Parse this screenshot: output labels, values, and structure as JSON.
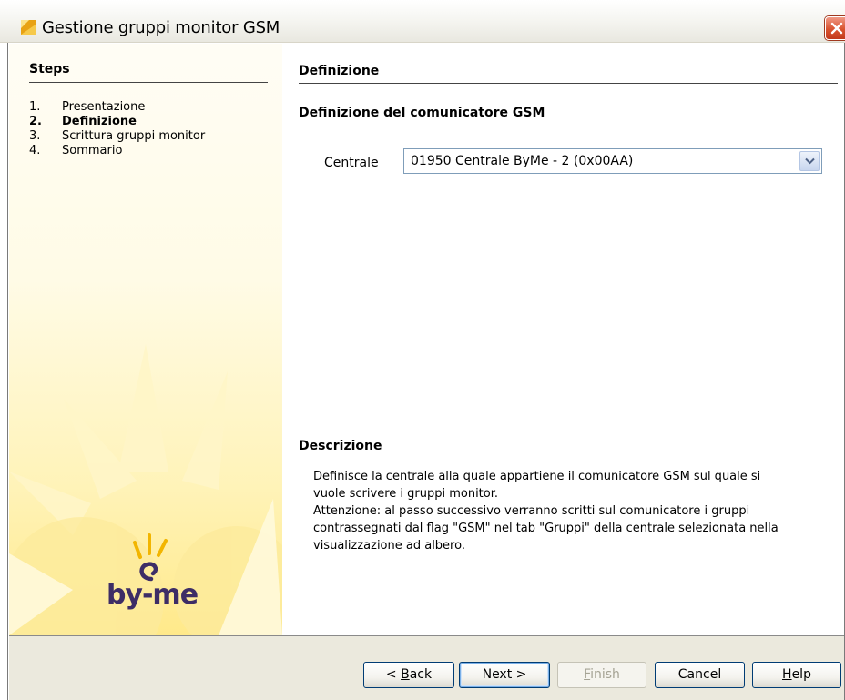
{
  "window": {
    "title": "Gestione gruppi monitor GSM"
  },
  "steps": {
    "heading": "Steps",
    "items": [
      {
        "num": "1.",
        "label": "Presentazione",
        "current": false
      },
      {
        "num": "2.",
        "label": "Definizione",
        "current": true
      },
      {
        "num": "3.",
        "label": "Scrittura gruppi monitor",
        "current": false
      },
      {
        "num": "4.",
        "label": "Sommario",
        "current": false
      }
    ],
    "logo_text": "by-me"
  },
  "content": {
    "heading": "Definizione",
    "section_title": "Definizione del comunicatore GSM",
    "centrale_label": "Centrale",
    "centrale_value": "01950 Centrale ByMe - 2 (0x00AA)",
    "description_title": "Descrizione",
    "description_lines": [
      "Definisce la centrale alla quale appartiene il comunicatore GSM sul quale si",
      "vuole scrivere i gruppi monitor.",
      "Attenzione: al passo successivo verranno scritti sul comunicatore i gruppi",
      "contrassegnati dal flag \"GSM\" nel tab \"Gruppi\" della centrale selezionata nella",
      "visualizzazione ad albero."
    ]
  },
  "buttons": {
    "back": {
      "prefix": "< ",
      "mnemonic": "B",
      "rest": "ack"
    },
    "next": {
      "label": "Next >"
    },
    "finish": {
      "mnemonic": "F",
      "rest": "inish",
      "enabled": false
    },
    "cancel": {
      "label": "Cancel"
    },
    "help": {
      "mnemonic": "H",
      "rest": "elp"
    }
  },
  "colors": {
    "logo_purple": "#3d2d66",
    "panel_yellow": "#ffe98a",
    "close_red": "#d9532f",
    "bottom_bar": "#ebe9dd"
  }
}
